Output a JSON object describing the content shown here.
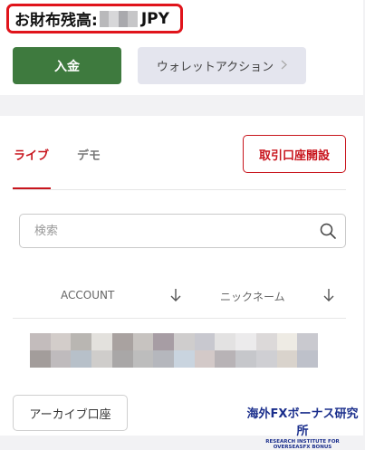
{
  "balance": {
    "label": "お財布残高:",
    "currency": "JPY",
    "mosaic_colors": [
      "#b9b9bb",
      "#d7d7d9",
      "#a9a9ad",
      "#c6c6c8"
    ]
  },
  "actions": {
    "deposit_label": "入金",
    "wallet_label": "ウォレットアクション",
    "wallet_icon": "chevron-right-icon"
  },
  "tabs": [
    {
      "label": "ライブ",
      "active": true
    },
    {
      "label": "デモ",
      "active": false
    }
  ],
  "open_account_label": "取引口座開設",
  "search": {
    "placeholder": "検索",
    "value": "",
    "icon": "search-icon"
  },
  "columns": [
    {
      "label": "ACCOUNT",
      "sort_icon": "arrow-down-icon"
    },
    {
      "label": "ニックネーム",
      "sort_icon": "arrow-down-icon"
    }
  ],
  "account_row_mosaic": [
    "#c3bcbc",
    "#d3cdca",
    "#b9b6b2",
    "#e3e1dd",
    "#a9a2a0",
    "#c7c3c0",
    "#a79da4",
    "#cfcdcd",
    "#c8c8cf",
    "#e3e2e2",
    "#ecebec",
    "#dcd9d9",
    "#eeebe4",
    "#c9c9cf",
    "#a39d9b",
    "#bfbbbd",
    "#b7c0c9",
    "#cfcdcb",
    "#a9a7a7",
    "#bdbdbd",
    "#b5b7bd",
    "#c9d4df",
    "#d3c9c8",
    "#b8b3b6",
    "#c6c7cb",
    "#cfcfd3",
    "#d9d3cc",
    "#bec1ca"
  ],
  "archive_label": "アーカイブ口座",
  "watermark": {
    "main": "海外FXボーナス研究所",
    "sub": "RESEARCH INSTITUTE FOR OVERSEASFX BONUS"
  }
}
